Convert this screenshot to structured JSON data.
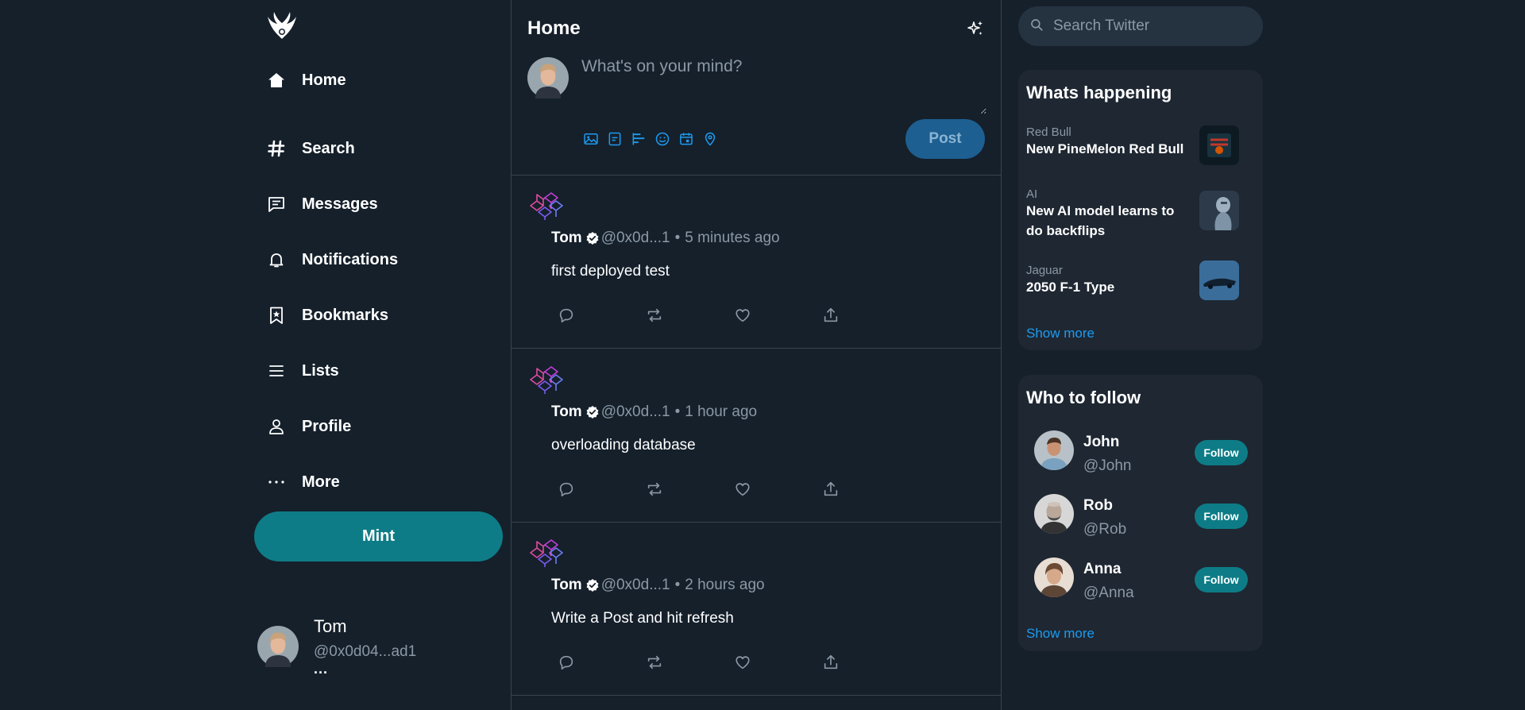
{
  "brand": {
    "logo_icon": "winged-emblem-icon"
  },
  "nav": {
    "items": [
      {
        "label": "Home",
        "icon": "home-icon"
      },
      {
        "label": "Search",
        "icon": "hashtag-icon"
      },
      {
        "label": "Messages",
        "icon": "message-icon"
      },
      {
        "label": "Notifications",
        "icon": "bell-icon"
      },
      {
        "label": "Bookmarks",
        "icon": "bookmark-icon"
      },
      {
        "label": "Lists",
        "icon": "list-icon"
      },
      {
        "label": "Profile",
        "icon": "person-icon"
      },
      {
        "label": "More",
        "icon": "more-icon"
      }
    ],
    "mint_label": "Mint"
  },
  "account": {
    "name": "Tom",
    "handle": "@0x0d04...ad1",
    "menu_dots": "..."
  },
  "feed": {
    "title": "Home",
    "composer": {
      "placeholder": "What's on your mind?",
      "post_label": "Post"
    },
    "posts": [
      {
        "name": "Tom",
        "handle": "@0x0d...1",
        "separator": "•",
        "time": "5 minutes ago",
        "text": "first deployed test"
      },
      {
        "name": "Tom",
        "handle": "@0x0d...1",
        "separator": "•",
        "time": "1 hour ago",
        "text": "overloading database"
      },
      {
        "name": "Tom",
        "handle": "@0x0d...1",
        "separator": "•",
        "time": "2 hours ago",
        "text": "Write a Post and hit refresh"
      }
    ]
  },
  "search": {
    "placeholder": "Search Twitter"
  },
  "trends": {
    "title": "Whats happening",
    "items": [
      {
        "category": "Red Bull",
        "title": "New PineMelon Red Bull"
      },
      {
        "category": "AI",
        "title": "New AI model learns to do backflips"
      },
      {
        "category": "Jaguar",
        "title": "2050 F-1 Type"
      }
    ],
    "show_more": "Show more"
  },
  "who_to_follow": {
    "title": "Who to follow",
    "items": [
      {
        "name": "John",
        "handle": "@John",
        "button": "Follow"
      },
      {
        "name": "Rob",
        "handle": "@Rob",
        "button": "Follow"
      },
      {
        "name": "Anna",
        "handle": "@Anna",
        "button": "Follow"
      }
    ],
    "show_more": "Show more"
  },
  "colors": {
    "background": "#15202b",
    "card": "#1e2732",
    "accent_teal": "#0e7c86",
    "link_blue": "#1d9bf0",
    "muted_text": "#8b98a5",
    "divider": "#38444d"
  }
}
